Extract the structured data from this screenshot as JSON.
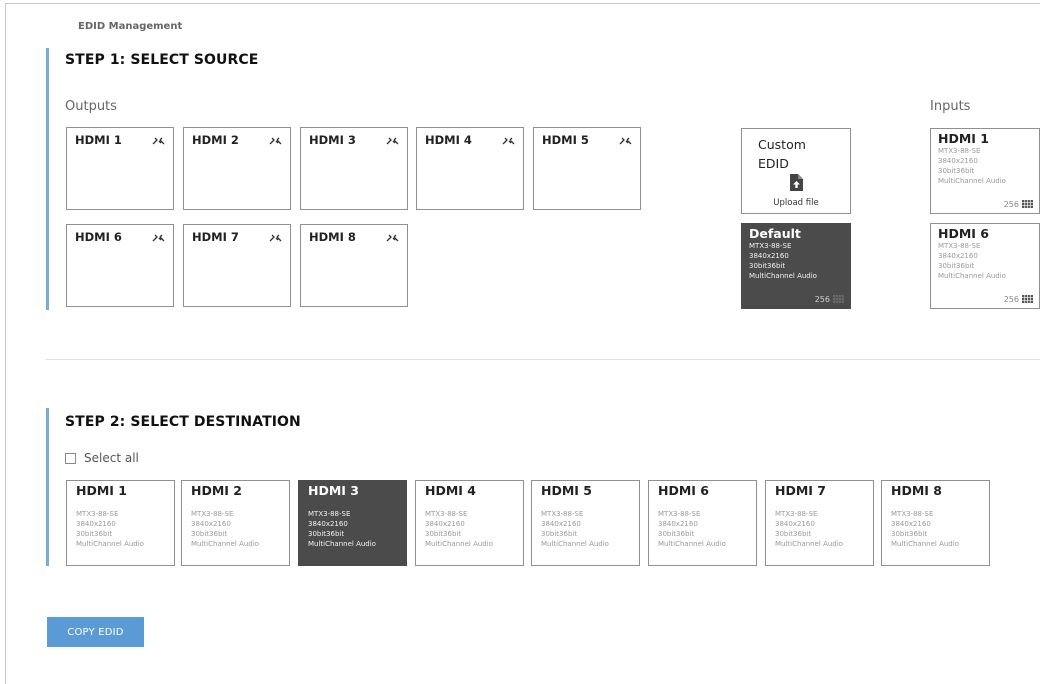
{
  "page_title": "EDID Management",
  "step1": {
    "title": "STEP 1: SELECT SOURCE",
    "outputs_label": "Outputs",
    "inputs_label": "Inputs",
    "outputs": [
      "HDMI 1",
      "HDMI 2",
      "HDMI 3",
      "HDMI 4",
      "HDMI 5",
      "HDMI 6",
      "HDMI 7",
      "HDMI 8"
    ],
    "output_icon": "unlinked-chain-icon",
    "custom": {
      "title": "Custom EDID",
      "upload_label": "Upload file",
      "icon": "file-upload-icon"
    },
    "default_edid": {
      "name": "Default",
      "lines": [
        "MTX3-88-SE",
        "3840x2160",
        "30bit36bit",
        "MultiChannel Audio"
      ],
      "count": "256",
      "selected": true
    },
    "inputs": [
      {
        "name": "HDMI 1",
        "lines": [
          "MTX3-88-SE",
          "3840x2160",
          "30bit36bit",
          "MultiChannel Audio"
        ],
        "count": "256"
      },
      {
        "name": "HDMI 6",
        "lines": [
          "MTX3-88-SE",
          "3840x2160",
          "30bit36bit",
          "MultiChannel Audio"
        ],
        "count": "256"
      }
    ]
  },
  "step2": {
    "title": "STEP 2: SELECT DESTINATION",
    "select_all_label": "Select all",
    "select_all_checked": false,
    "destinations": [
      {
        "name": "HDMI 1",
        "lines": [
          "MTX3-88-SE",
          "3840x2160",
          "30bit36bit",
          "MultiChannel Audio"
        ],
        "selected": false
      },
      {
        "name": "HDMI 2",
        "lines": [
          "MTX3-88-SE",
          "3840x2160",
          "30bit36bit",
          "MultiChannel Audio"
        ],
        "selected": false
      },
      {
        "name": "HDMI 3",
        "lines": [
          "MTX3-88-SE",
          "3840x2160",
          "30bit36bit",
          "MultiChannel Audio"
        ],
        "selected": true
      },
      {
        "name": "HDMI 4",
        "lines": [
          "MTX3-88-SE",
          "3840x2160",
          "30bit36bit",
          "MultiChannel Audio"
        ],
        "selected": false
      },
      {
        "name": "HDMI 5",
        "lines": [
          "MTX3-88-SE",
          "3840x2160",
          "30bit36bit",
          "MultiChannel Audio"
        ],
        "selected": false
      },
      {
        "name": "HDMI 6",
        "lines": [
          "MTX3-88-SE",
          "3840x2160",
          "30bit36bit",
          "MultiChannel Audio"
        ],
        "selected": false
      },
      {
        "name": "HDMI 7",
        "lines": [
          "MTX3-88-SE",
          "3840x2160",
          "30bit36bit",
          "MultiChannel Audio"
        ],
        "selected": false
      },
      {
        "name": "HDMI 8",
        "lines": [
          "MTX3-88-SE",
          "3840x2160",
          "30bit36bit",
          "MultiChannel Audio"
        ],
        "selected": false
      }
    ]
  },
  "copy_button_label": "COPY EDID",
  "colors": {
    "accent": "#5b9bd5",
    "step_bar": "#7ea8dc",
    "selected_card": "#4b4b4b",
    "border": "#909090"
  }
}
